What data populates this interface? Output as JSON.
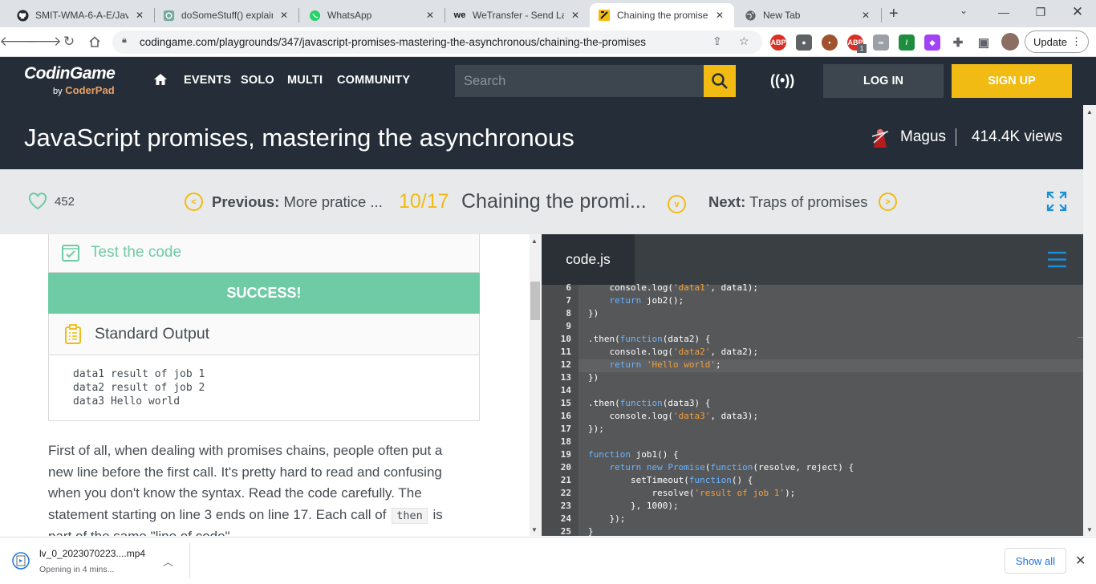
{
  "browser": {
    "tabs": [
      {
        "title": "SMIT-WMA-6-A-E/Jav",
        "icon": "github-icon"
      },
      {
        "title": "doSomeStuff() explain",
        "icon": "chatgpt-icon"
      },
      {
        "title": "WhatsApp",
        "icon": "whatsapp-icon"
      },
      {
        "title": "WeTransfer - Send Lar",
        "icon": "wetransfer-icon"
      },
      {
        "title": "Chaining the promises",
        "icon": "codingame-icon",
        "active": true
      },
      {
        "title": "New Tab",
        "icon": "globe-icon"
      }
    ],
    "url": "codingame.com/playgrounds/347/javascript-promises-mastering-the-asynchronous/chaining-the-promises",
    "update_label": "Update",
    "ext_badge": "1"
  },
  "site": {
    "logo": "CodinGame",
    "logo_by": "by",
    "logo_coderpad": "CoderPad",
    "nav": [
      "EVENTS",
      "SOLO",
      "MULTI",
      "COMMUNITY"
    ],
    "search_placeholder": "Search",
    "login": "LOG IN",
    "signup": "SIGN UP",
    "accent": "#f2bb13",
    "header_bg": "#252e38"
  },
  "page": {
    "title": "JavaScript promises, mastering the asynchronous",
    "author": "Magus",
    "views": "414.4K views",
    "likes": "452",
    "previous_label": "Previous:",
    "previous_title": "More pratice ...",
    "progress": "10/17",
    "current_title": "Chaining the promi...",
    "next_label": "Next:",
    "next_title": "Traps of promises"
  },
  "test": {
    "label": "Test the code",
    "status": "SUCCESS!",
    "status_color": "#6ecba6",
    "output_label": "Standard Output",
    "output_lines": [
      "data1 result of job 1",
      "data2 result of job 2",
      "data3 Hello world"
    ]
  },
  "text": {
    "line1": "First of all, when dealing with promises chains, people often put a",
    "line2": "new line before the first call. It's pretty hard to read and confusing",
    "line3": "when you don't know the syntax. Read the code carefully. The",
    "line4a": "statement starting on line 3 ends on line 17. Each call of",
    "line4code": "then",
    "line4b": "is",
    "line5": "part of the same \"line of code\"."
  },
  "editor": {
    "filename": "code.js",
    "lines": [
      {
        "n": "6",
        "code": [
          [
            "    ",
            ""
          ],
          [
            "console.log(",
            "fn"
          ],
          [
            "'data1'",
            "str"
          ],
          [
            ", data1);",
            "fn"
          ]
        ]
      },
      {
        "n": "7",
        "code": [
          [
            "    ",
            ""
          ],
          [
            "return",
            "kw"
          ],
          [
            " job2();",
            "fn"
          ]
        ]
      },
      {
        "n": "8",
        "code": [
          [
            "})",
            "fn"
          ]
        ]
      },
      {
        "n": "9",
        "code": []
      },
      {
        "n": "10",
        "code": [
          [
            ".then(",
            "fn"
          ],
          [
            "function",
            "kw"
          ],
          [
            "(data2) {",
            "fn"
          ]
        ]
      },
      {
        "n": "11",
        "code": [
          [
            "    ",
            ""
          ],
          [
            "console.log(",
            "fn"
          ],
          [
            "'data2'",
            "str"
          ],
          [
            ", data2);",
            "fn"
          ]
        ]
      },
      {
        "n": "12",
        "code": [
          [
            "    ",
            ""
          ],
          [
            "return",
            "kw"
          ],
          [
            " ",
            ""
          ],
          [
            "'Hello world'",
            "str"
          ],
          [
            ";",
            "fn"
          ]
        ]
      },
      {
        "n": "13",
        "code": [
          [
            "})",
            "fn"
          ]
        ]
      },
      {
        "n": "14",
        "code": []
      },
      {
        "n": "15",
        "code": [
          [
            ".then(",
            "fn"
          ],
          [
            "function",
            "kw"
          ],
          [
            "(data3) {",
            "fn"
          ]
        ]
      },
      {
        "n": "16",
        "code": [
          [
            "    ",
            ""
          ],
          [
            "console.log(",
            "fn"
          ],
          [
            "'data3'",
            "str"
          ],
          [
            ", data3);",
            "fn"
          ]
        ]
      },
      {
        "n": "17",
        "code": [
          [
            "});",
            "fn"
          ]
        ]
      },
      {
        "n": "18",
        "code": []
      },
      {
        "n": "19",
        "code": [
          [
            "function",
            "kw"
          ],
          [
            " job1() {",
            "fn"
          ]
        ]
      },
      {
        "n": "20",
        "code": [
          [
            "    ",
            ""
          ],
          [
            "return",
            "kw"
          ],
          [
            " ",
            ""
          ],
          [
            "new",
            "kw"
          ],
          [
            " ",
            ""
          ],
          [
            "Promise",
            "kw"
          ],
          [
            "(",
            "fn"
          ],
          [
            "function",
            "kw"
          ],
          [
            "(resolve, reject) {",
            "fn"
          ]
        ]
      },
      {
        "n": "21",
        "code": [
          [
            "        ",
            ""
          ],
          [
            "setTimeout(",
            "fn"
          ],
          [
            "function",
            "kw"
          ],
          [
            "() {",
            "fn"
          ]
        ]
      },
      {
        "n": "22",
        "code": [
          [
            "            ",
            ""
          ],
          [
            "resolve(",
            "fn"
          ],
          [
            "'result of job 1'",
            "str"
          ],
          [
            ");",
            "fn"
          ]
        ]
      },
      {
        "n": "23",
        "code": [
          [
            "        }, 1000);",
            "fn"
          ]
        ]
      },
      {
        "n": "24",
        "code": [
          [
            "    });",
            "fn"
          ]
        ]
      },
      {
        "n": "25",
        "code": [
          [
            "}",
            "fn"
          ]
        ]
      }
    ]
  },
  "download": {
    "filename": "lv_0_2023070223....mp4",
    "status": "Opening in 4 mins...",
    "show_all": "Show all"
  }
}
